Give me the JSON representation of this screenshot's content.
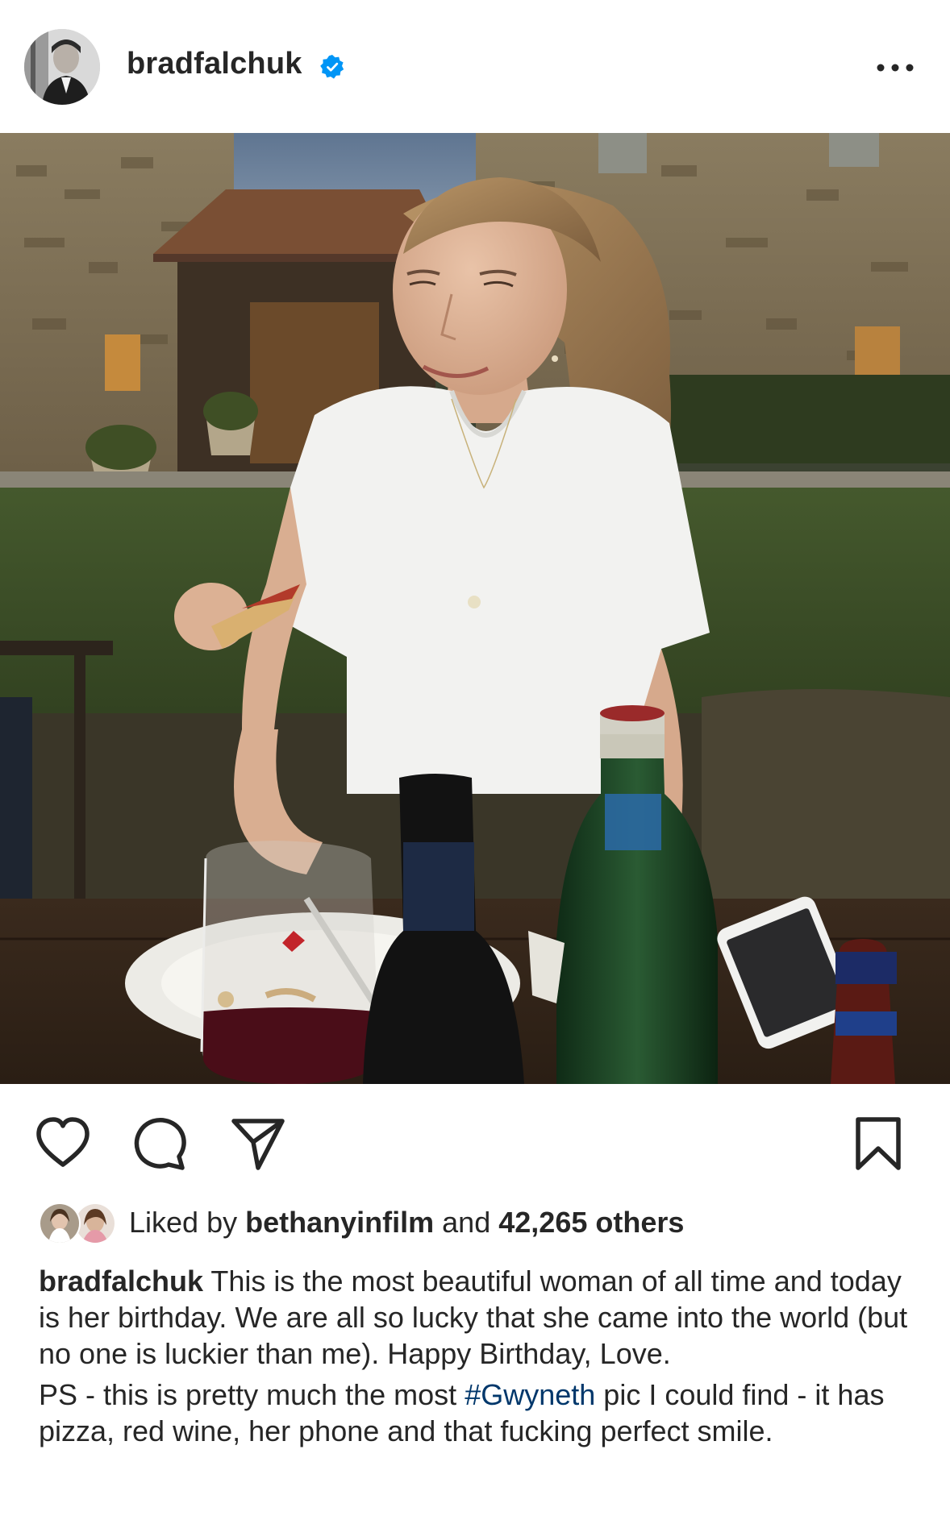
{
  "post": {
    "username": "bradfalchuk",
    "verified": true,
    "avatar_icon": "profile-photo-avatar",
    "menu_icon": "more-options-icon",
    "photo_description_icon": "post-photo"
  },
  "actions": {
    "like_icon": "heart-icon",
    "comment_icon": "comment-icon",
    "share_icon": "paper-plane-icon",
    "save_icon": "bookmark-icon"
  },
  "likes": {
    "prefix": "Liked by",
    "liker": "bethanyinfilm",
    "joiner": "and",
    "count_text": "42,265 others"
  },
  "caption": {
    "username": "bradfalchuk",
    "text_1": "This is the most beautiful woman of all time and today is her birthday.  We are all so lucky that she came into the world (but no one is luckier than me). Happy Birthday, Love.",
    "text_2_before": "PS - this is pretty much the most",
    "hashtag": "#Gwyneth",
    "text_2_after": "pic I could find - it has pizza, red wine, her phone and that fucking perfect smile."
  },
  "colors": {
    "text": "#262626",
    "hashtag": "#00376b",
    "verified": "#0095f6"
  }
}
